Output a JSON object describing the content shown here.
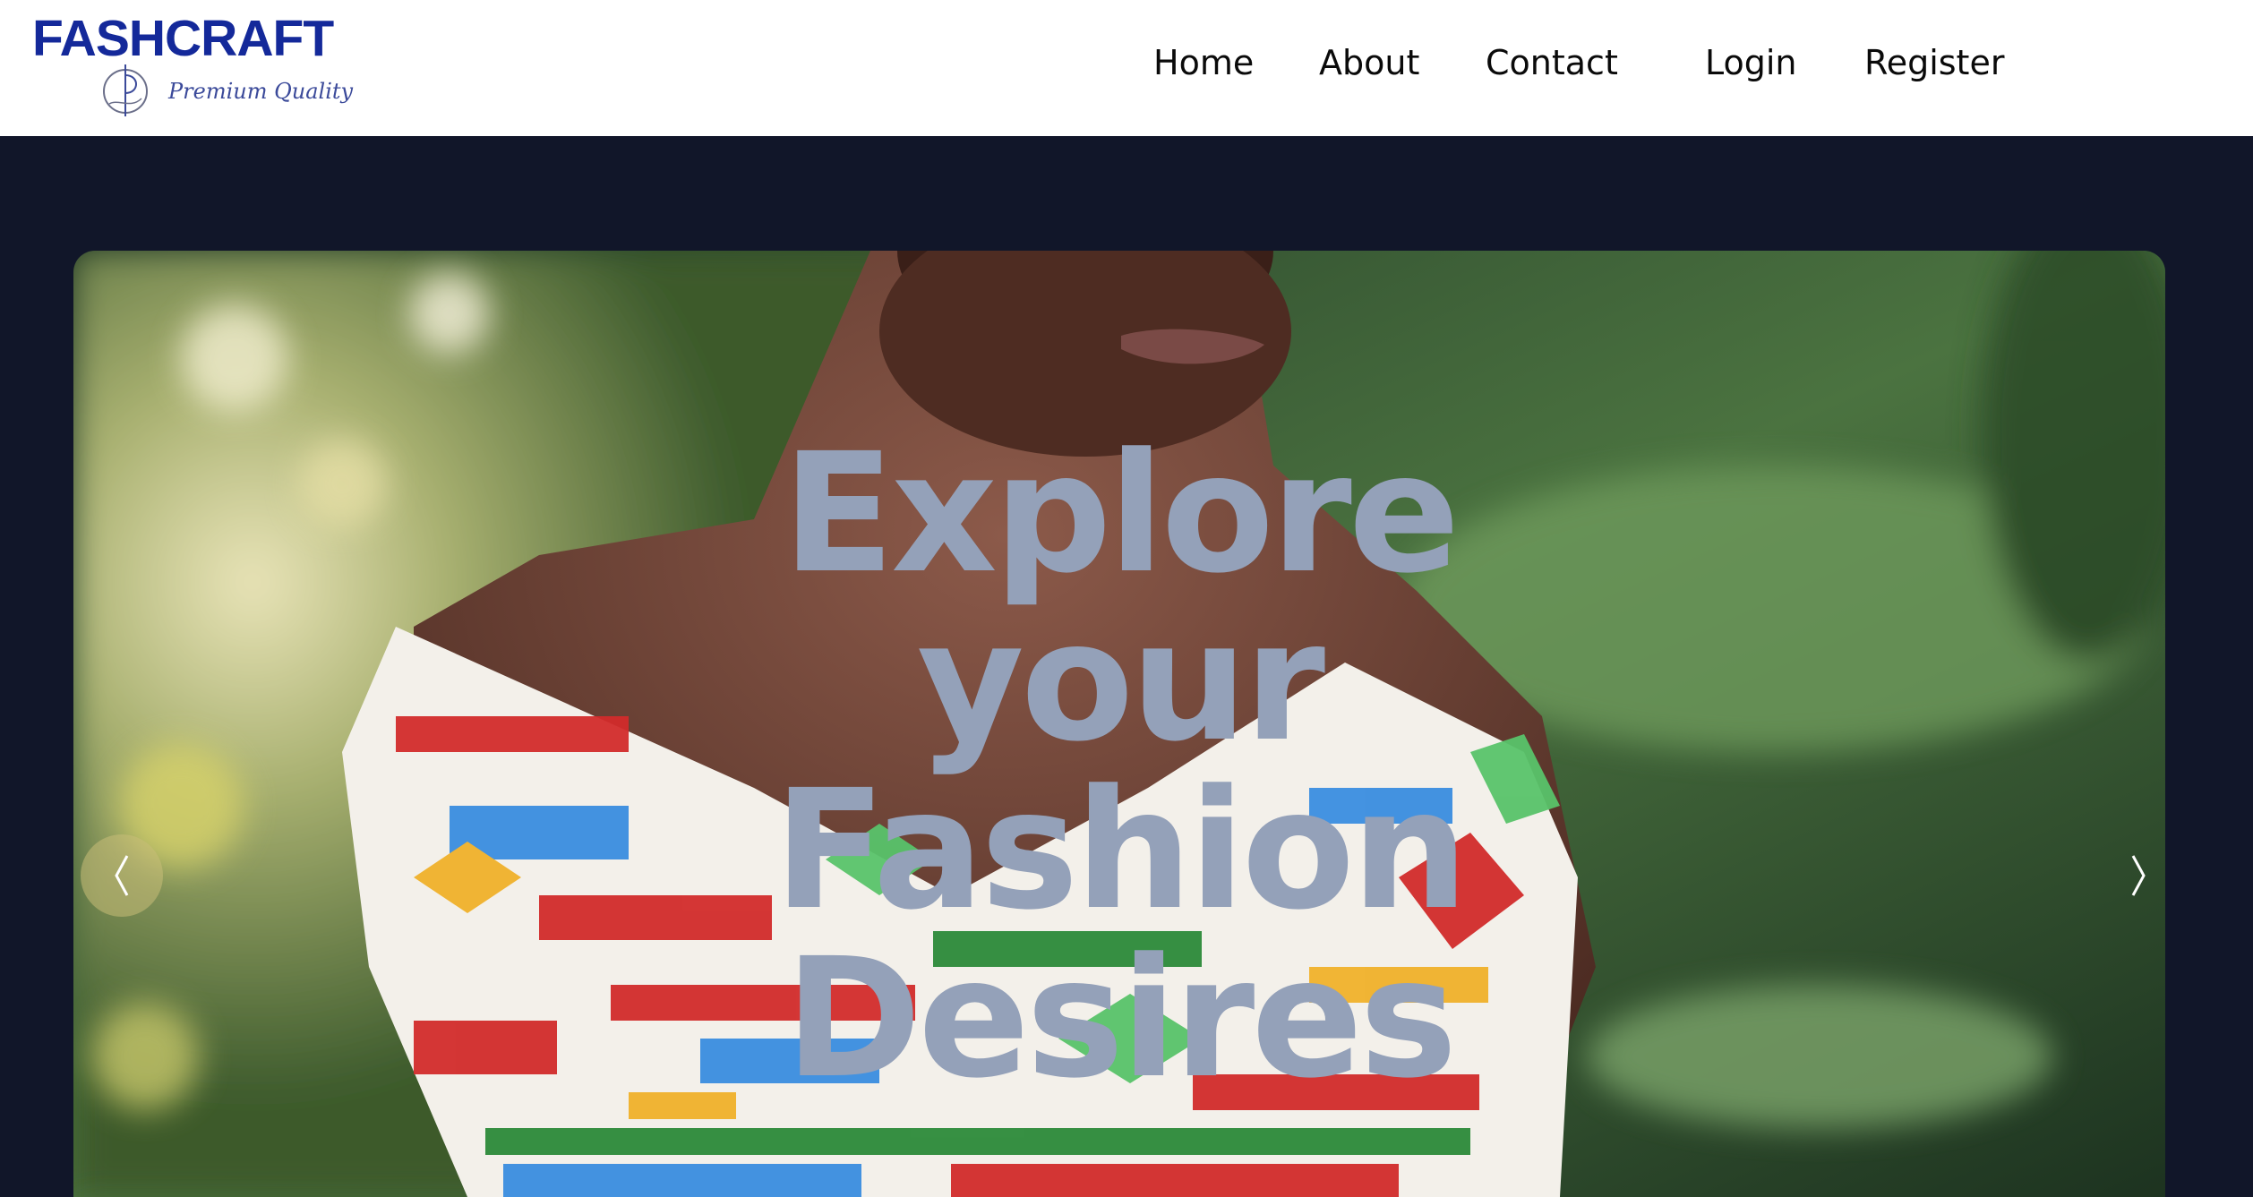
{
  "brand": {
    "name": "FASHCRAFT",
    "tagline": "Premium Quality",
    "logo_icon": "needle-thread-icon",
    "color": "#14299a"
  },
  "nav": {
    "items": [
      {
        "label": "Home"
      },
      {
        "label": "About"
      },
      {
        "label": "Contact"
      },
      {
        "label": "Login"
      },
      {
        "label": "Register"
      }
    ]
  },
  "hero": {
    "title_lines": [
      "Explore",
      "your",
      "Fashion",
      "Desires"
    ],
    "image": "woman-in-african-print-off-shoulder-dress-photo",
    "prev_icon": "chevron-left-icon",
    "next_icon": "chevron-right-icon",
    "title_color": "#94a1b9",
    "background_color": "#111629"
  }
}
